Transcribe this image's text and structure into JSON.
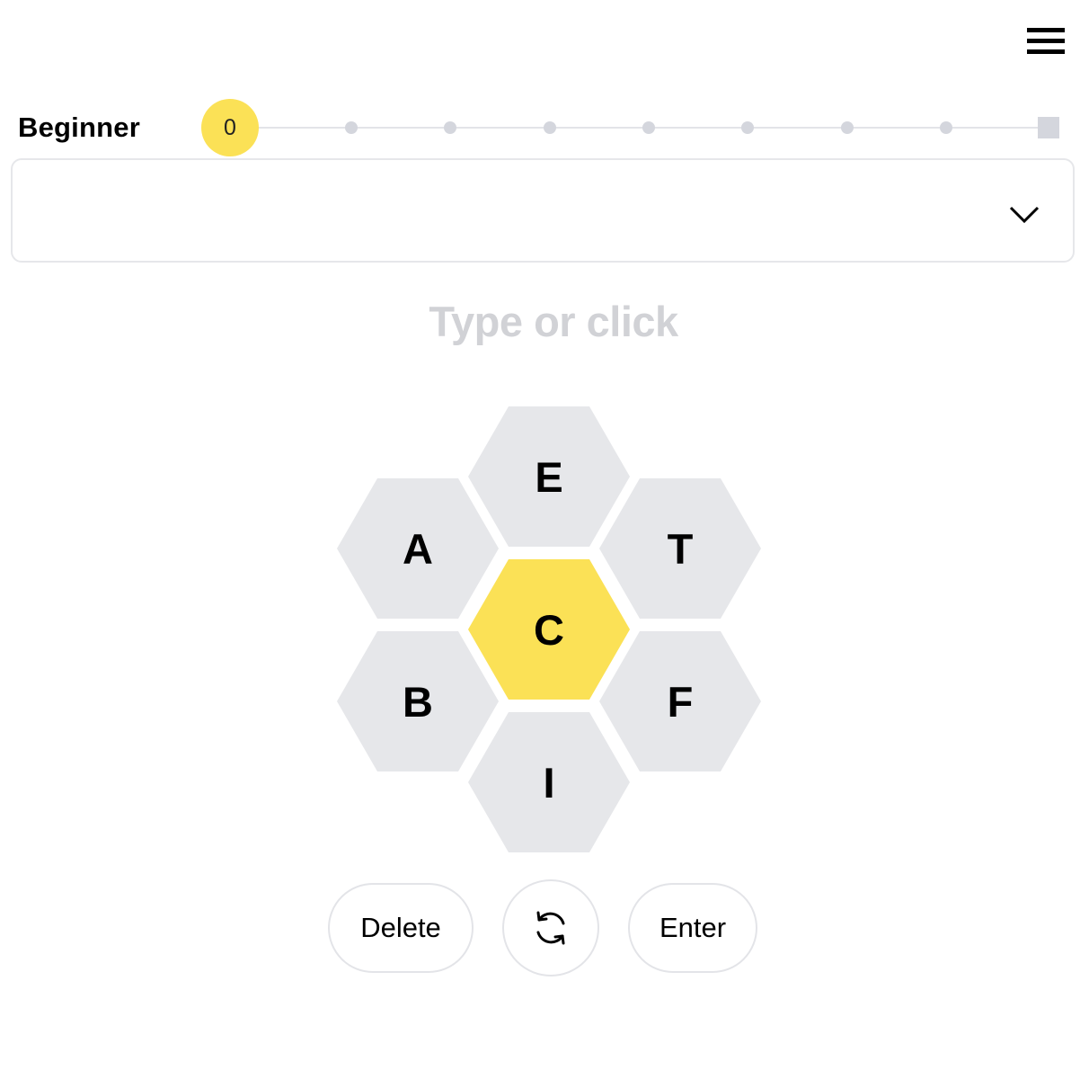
{
  "header": {
    "menu_icon": "hamburger-menu-icon"
  },
  "progress": {
    "rank": "Beginner",
    "score": "0",
    "levels": 9,
    "current_level": 0,
    "marker_color": "#fbe156",
    "dot_color": "#d4d6dd"
  },
  "wordlist": {
    "found_words": [],
    "toggle_icon": "chevron-down-icon"
  },
  "input": {
    "placeholder": "Type or click"
  },
  "hive": {
    "center_letter": "C",
    "outer_letters": [
      "E",
      "T",
      "F",
      "I",
      "B",
      "A"
    ],
    "center_color": "#fbe156",
    "outer_color": "#e6e7ea"
  },
  "controls": {
    "delete_label": "Delete",
    "shuffle_icon": "shuffle-icon",
    "enter_label": "Enter"
  }
}
